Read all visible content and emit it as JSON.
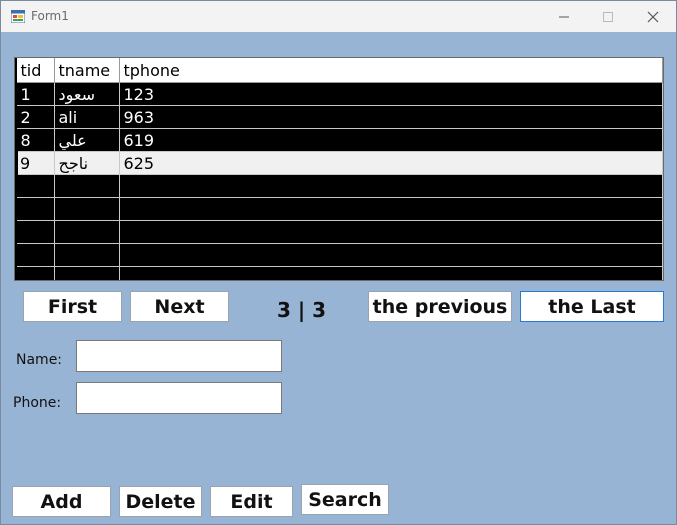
{
  "window": {
    "title": "Form1"
  },
  "grid": {
    "columns": [
      "tid",
      "tname",
      "tphone"
    ],
    "rows": [
      {
        "tid": "1",
        "tname": "سعود",
        "tphone": "123"
      },
      {
        "tid": "2",
        "tname": "ali",
        "tphone": "963"
      },
      {
        "tid": "8",
        "tname": "علي",
        "tphone": "619"
      },
      {
        "tid": "9",
        "tname": "ناجح",
        "tphone": "625"
      }
    ]
  },
  "navigation": {
    "first_label": "First",
    "next_label": "Next",
    "counter": "3 | 3",
    "previous_label": "the previous",
    "last_label": "the Last"
  },
  "form": {
    "name_label": "Name:",
    "name_value": "",
    "phone_label": "Phone:",
    "phone_value": ""
  },
  "actions": {
    "add_label": "Add",
    "delete_label": "Delete",
    "edit_label": "Edit",
    "search_label": "Search"
  }
}
